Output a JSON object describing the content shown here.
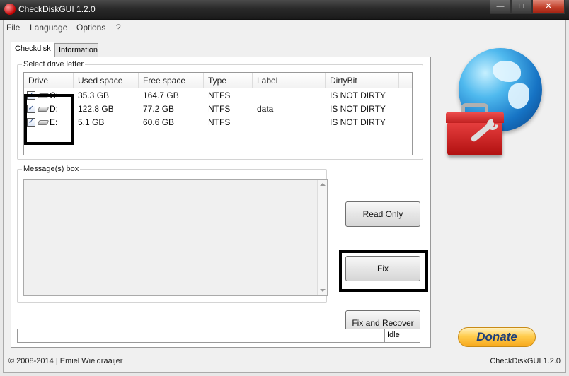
{
  "window": {
    "title": "CheckDiskGUI 1.2.0",
    "minimize": "—",
    "maximize": "□",
    "close": "✕"
  },
  "menu": {
    "items": [
      "File",
      "Language",
      "Options",
      "?"
    ]
  },
  "tabs": [
    {
      "label": "Checkdisk",
      "active": true
    },
    {
      "label": "Information",
      "active": false
    }
  ],
  "drive_group": {
    "title": "Select drive letter",
    "columns": [
      "Drive",
      "Used space",
      "Free space",
      "Type",
      "Label",
      "DirtyBit"
    ],
    "rows": [
      {
        "checked": true,
        "drive": "C:",
        "used": "35.3 GB",
        "free": "164.7 GB",
        "type": "NTFS",
        "label": "",
        "dirty": "IS NOT DIRTY"
      },
      {
        "checked": true,
        "drive": "D:",
        "used": "122.8 GB",
        "free": "77.2 GB",
        "type": "NTFS",
        "label": "data",
        "dirty": "IS NOT DIRTY"
      },
      {
        "checked": true,
        "drive": "E:",
        "used": "5.1 GB",
        "free": "60.6 GB",
        "type": "NTFS",
        "label": "",
        "dirty": "IS NOT DIRTY"
      }
    ],
    "check_mark": "✓"
  },
  "messages": {
    "title": "Message(s) box"
  },
  "buttons": {
    "read_only": "Read Only",
    "fix": "Fix",
    "fix_and_recover": "Fix and Recover",
    "donate": "Donate"
  },
  "status": {
    "text": "Idle"
  },
  "footer": {
    "copyright": "© 2008-2014 | Emiel Wieldraaijer",
    "version": "CheckDiskGUI 1.2.0"
  },
  "colors": {
    "titlebar": "#2a2a2a",
    "close_button": "#c2402a",
    "donate": "#ffcc4d",
    "donate_text": "#1e3f7a"
  }
}
